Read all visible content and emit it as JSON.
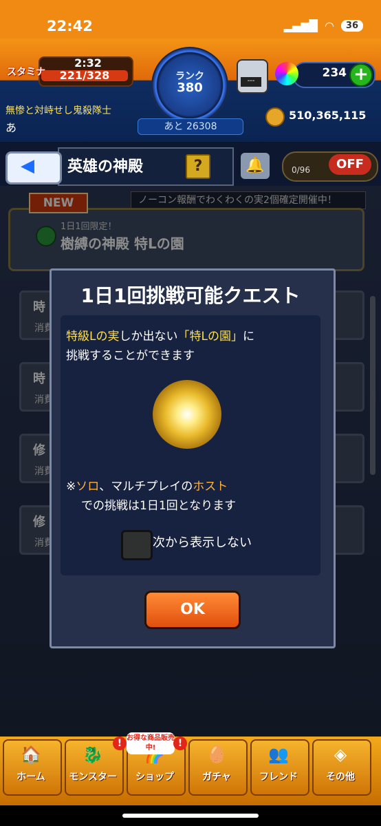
{
  "status_bar": {
    "time": "22:42",
    "battery": "36"
  },
  "hud": {
    "stamina_label": "スタミナ",
    "stamina_timer": "2:32",
    "stamina_value": "221/328",
    "rank_label": "ランク",
    "rank_value": "380",
    "rank_next": "あと 26308",
    "potion_screen": "---",
    "orb_count": "234",
    "orb_add": "+",
    "player_title": "無惨と対峙せし鬼殺隊士",
    "player_name": "あ",
    "coin_value": "510,365,115"
  },
  "header": {
    "title": "英雄の神殿",
    "help": "?",
    "helper_count": "0/96",
    "toggle": "OFF"
  },
  "background": {
    "banner": "ノーコン報酬でわくわくの実2個確定開催中！",
    "new_badge": "NEW",
    "quest_small": "1日1回限定！",
    "quest_title": "樹縛の神殿 特Lの園",
    "rows": [
      {
        "label": "時",
        "sub": "消費"
      },
      {
        "label": "時",
        "sub": "消費"
      },
      {
        "label": "修",
        "sub": "消費"
      },
      {
        "label": "修",
        "sub": "消費"
      }
    ]
  },
  "modal": {
    "title": "1日1回挑戦可能クエスト",
    "desc_part1": "特級Lの実",
    "desc_part2": "しか出ない",
    "desc_part3": "「特Lの園」",
    "desc_part4": "に",
    "desc_line2": "挑戦することができます",
    "note_prefix": "※",
    "note_solo": "ソロ",
    "note_mid": "、マルチプレイの",
    "note_host": "ホスト",
    "note_line2": "での挑戦は1日1回となります",
    "checkbox_label": "次から表示しない",
    "ok": "OK"
  },
  "bottom_nav": {
    "items": [
      {
        "label": "ホーム"
      },
      {
        "label": "モンスター"
      },
      {
        "label": "ショップ"
      },
      {
        "label": "ガチャ"
      },
      {
        "label": "フレンド"
      },
      {
        "label": "その他"
      }
    ],
    "shop_bubble": "お得な商品販売中!",
    "alert": "!"
  }
}
